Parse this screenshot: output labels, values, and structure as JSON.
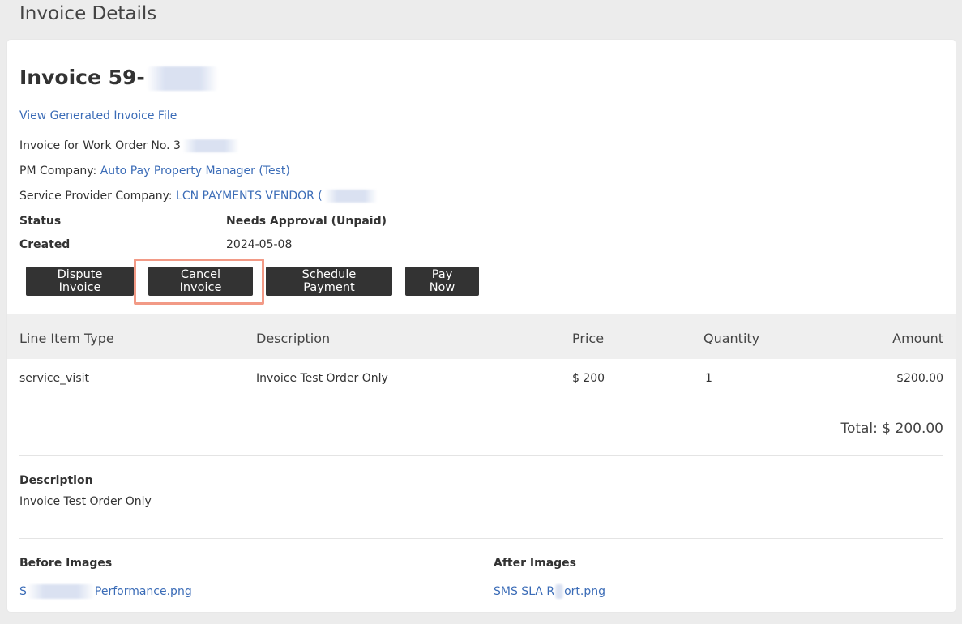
{
  "page": {
    "title": "Invoice Details"
  },
  "invoice": {
    "heading_prefix": "Invoice 59-",
    "view_file_link": "View Generated Invoice File",
    "work_order_label": "Invoice for Work Order No. 3",
    "pm_company_label": "PM Company: ",
    "pm_company_name": "Auto Pay Property Manager (Test)",
    "sp_company_label": "Service Provider Company: ",
    "sp_company_name": "LCN PAYMENTS VENDOR (",
    "status_label": "Status",
    "status_value": "Needs Approval (Unpaid)",
    "created_label": "Created",
    "created_value": "2024-05-08"
  },
  "actions": {
    "dispute": "Dispute Invoice",
    "cancel": "Cancel Invoice",
    "schedule": "Schedule Payment",
    "pay_now": "Pay Now"
  },
  "table": {
    "headers": [
      "Line Item Type",
      "Description",
      "Price",
      "Quantity",
      "Amount"
    ],
    "rows": [
      [
        "service_visit",
        "Invoice Test Order Only",
        "$ 200",
        "1",
        "$200.00"
      ]
    ],
    "total": "Total: $ 200.00"
  },
  "description": {
    "label": "Description",
    "text": "Invoice Test Order Only"
  },
  "images": {
    "before_label": "Before Images",
    "before_file_prefix": "S",
    "before_file_suffix": "Performance.png",
    "after_label": "After Images",
    "after_file_prefix": "SMS SLA R",
    "after_file_suffix": "ort.png"
  },
  "colors": {
    "link": "#3b6cb7",
    "button_bg": "#333333",
    "highlight_border": "#f29a86",
    "page_bg": "#ececec"
  }
}
